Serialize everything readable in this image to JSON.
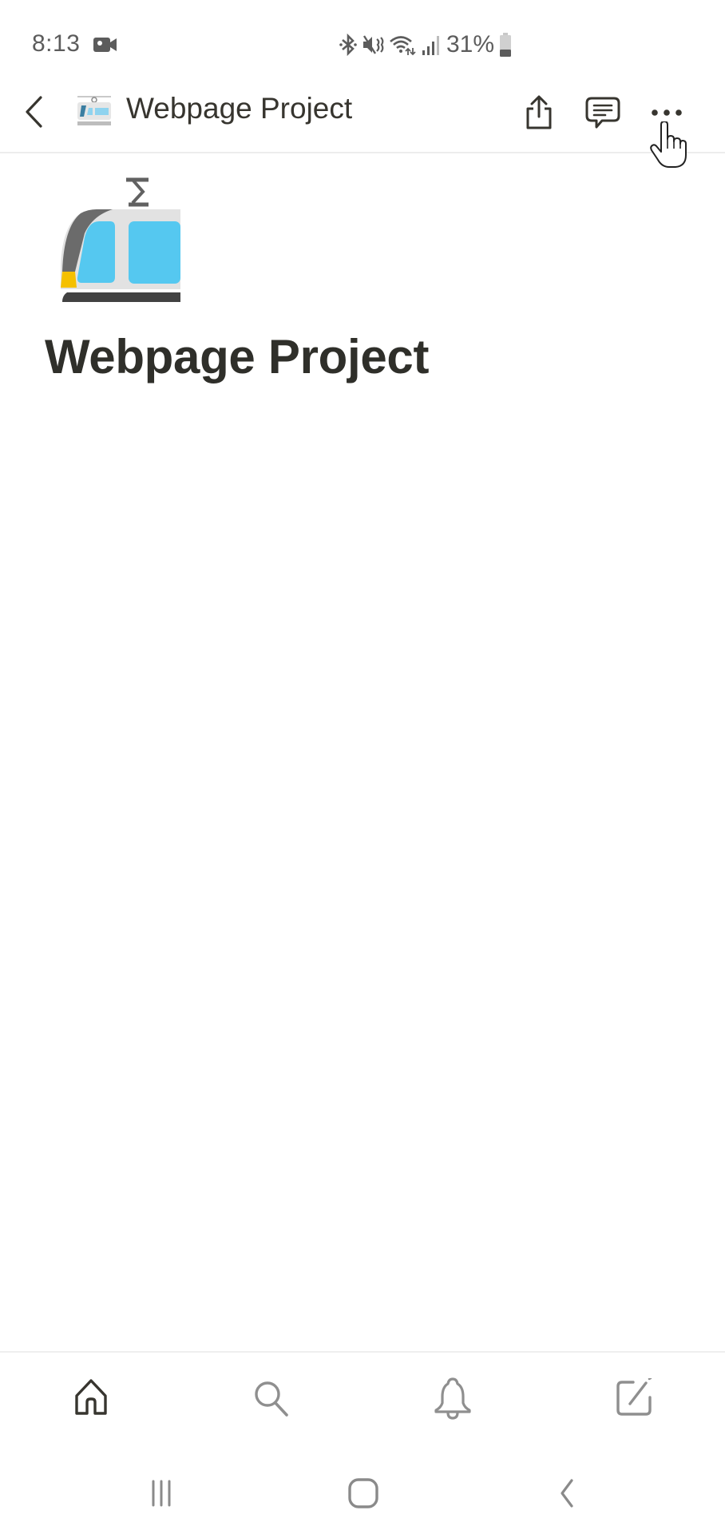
{
  "status_bar": {
    "time": "8:13",
    "recording_icon": "video-camera-icon",
    "icons": [
      "bluetooth-icon",
      "mute-icon",
      "wifi-icon",
      "signal-icon"
    ],
    "battery_percent": "31%",
    "battery_level": 0.31
  },
  "header": {
    "back_icon": "chevron-left-icon",
    "page_emoji": "tram-emoji",
    "title": "Webpage Project",
    "actions": [
      {
        "name": "share",
        "icon": "share-icon"
      },
      {
        "name": "comments",
        "icon": "comment-icon"
      },
      {
        "name": "more",
        "icon": "more-horizontal-icon"
      }
    ]
  },
  "page": {
    "icon": "tram-emoji",
    "title": "Webpage Project"
  },
  "bottom_nav": {
    "items": [
      {
        "name": "home",
        "icon": "home-icon",
        "active": true
      },
      {
        "name": "search",
        "icon": "search-icon",
        "active": false
      },
      {
        "name": "notifications",
        "icon": "bell-icon",
        "active": false
      },
      {
        "name": "new-page",
        "icon": "compose-icon",
        "active": false
      }
    ],
    "active_color": "#37352f",
    "inactive_color": "#8f8f8f"
  },
  "system_nav": {
    "items": [
      "recents-icon",
      "home-icon",
      "back-icon"
    ]
  }
}
